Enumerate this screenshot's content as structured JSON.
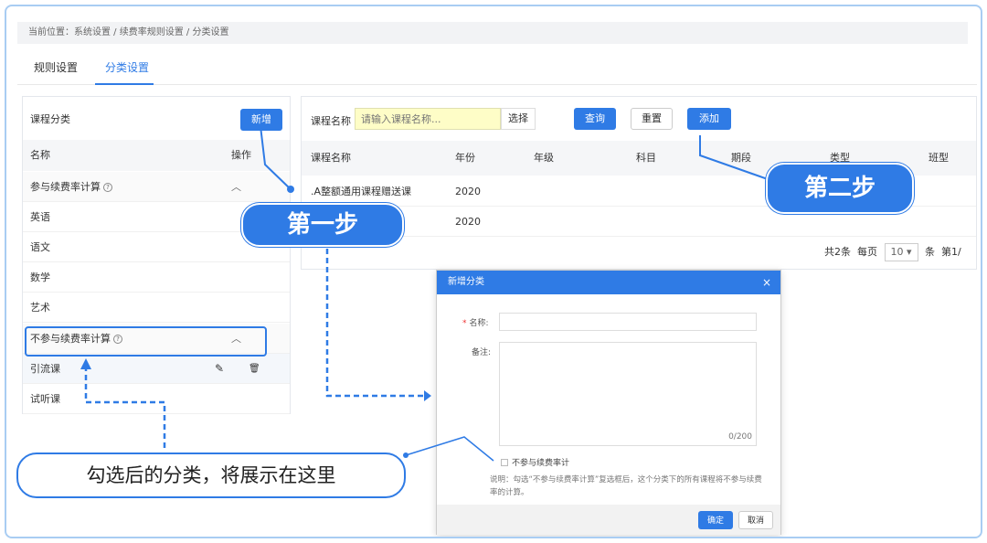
{
  "breadcrumb": "当前位置：系统设置 / 续费率规则设置 / 分类设置",
  "tabs": [
    {
      "label": "规则设置",
      "active": false
    },
    {
      "label": "分类设置",
      "active": true
    }
  ],
  "left_panel": {
    "title": "课程分类",
    "add_label": "新增",
    "col_name": "名称",
    "col_action": "操作",
    "groups": [
      {
        "label": "参与续费率计算",
        "items": [
          "英语",
          "语文",
          "数学",
          "艺术"
        ]
      },
      {
        "label": "不参与续费率计算",
        "items": [
          "引流课",
          "试听课"
        ]
      }
    ],
    "collapse_glyph": "︿",
    "edit_glyph": "✎",
    "delete_glyph": "🗑"
  },
  "search": {
    "label": "课程名称",
    "placeholder": "请输入课程名称...",
    "select_label": "选择",
    "query_label": "查询",
    "reset_label": "重置",
    "add_label": "添加"
  },
  "table": {
    "headers": [
      "课程名称",
      "年份",
      "年级",
      "科目",
      "期段",
      "类型",
      "班型"
    ],
    "rows": [
      {
        "name": ".A整额通用课程赠送课",
        "year": "2020"
      },
      {
        "name": "",
        "year": "2020"
      }
    ]
  },
  "pager": {
    "total": "共2条",
    "per_page_label": "每页",
    "per_page": "10",
    "unit": "条",
    "page": "第1/"
  },
  "modal": {
    "title": "新增分类",
    "close": "×",
    "name_label": "名称:",
    "required_mark": "*",
    "note_label": "备注:",
    "counter": "0/200",
    "checkbox_label": "不参与续费率计",
    "explain": "说明：勾选“不参与续费率计算”复选框后，这个分类下的所有课程将不参与续费率的计算。",
    "confirm": "确定",
    "cancel": "取消"
  },
  "callouts": {
    "step1": "第一步",
    "step2": "第二步",
    "note": "勾选后的分类，将展示在这里"
  },
  "colors": {
    "accent": "#2f7be5",
    "input_highlight": "#fefdc7"
  }
}
